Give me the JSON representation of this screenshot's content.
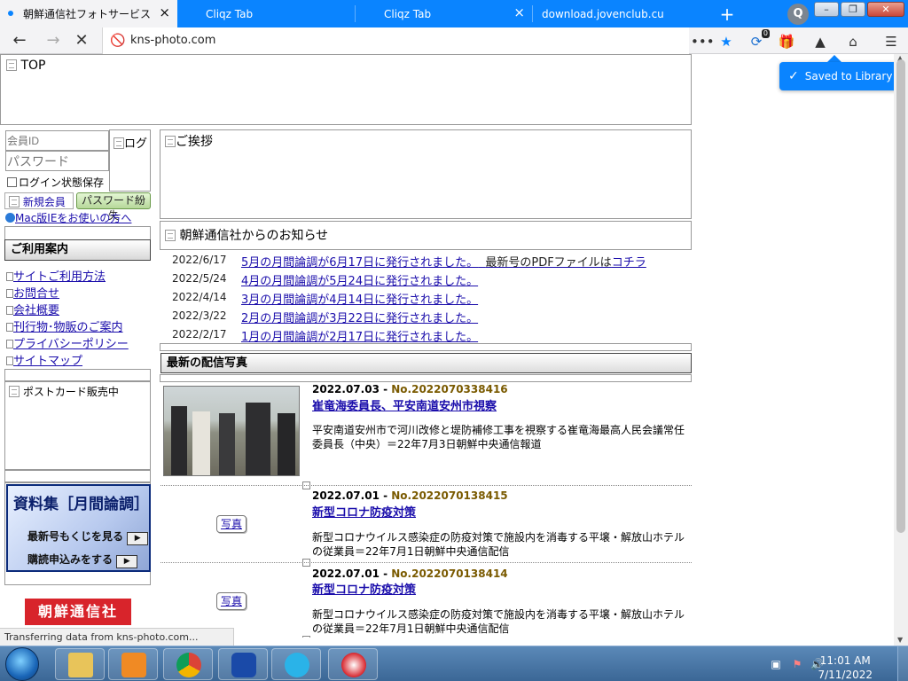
{
  "browser": {
    "tabs": [
      {
        "label": "朝鮮通信社フォトサービス",
        "active": true
      },
      {
        "label": "Cliqz Tab",
        "active": false
      },
      {
        "label": "Cliqz Tab",
        "active": false
      },
      {
        "label": "download.jovenclub.cu",
        "active": false
      }
    ],
    "url": "kns-photo.com",
    "toast": "Saved to Library!",
    "extension_badge": "0",
    "cliqz_logo": "Q"
  },
  "page": {
    "top_label": "TOP",
    "login": {
      "member_id_placeholder": "会員ID",
      "password_placeholder": "パスワード",
      "login_button": "ログ",
      "remember_label": "ログイン状態保存",
      "new_member": "新規会員",
      "forgot_password": "パスワード紛失",
      "mac_notice": "Mac版IEをお使いの方へ"
    },
    "guide_heading": "ご利用案内",
    "guide_links": [
      "サイトご利用方法",
      "お問合せ",
      "会社概要",
      "刊行物･物販のご案内",
      "プライバシーポリシー",
      "サイトマップ"
    ],
    "postcard": "ポストカード販売中",
    "banner": {
      "title": "資料集［月間論調］",
      "line1": "最新号もくじを見る",
      "line2": "購読申込みをする"
    },
    "kcna_logo": "朝鮮通信社",
    "greeting": "ご挨拶",
    "news_heading": "朝鮮通信社からのお知らせ",
    "news": [
      {
        "date": "2022/6/17",
        "text": "5月の月間論調が6月17日に発行されました。",
        "extra": "最新号のPDFファイルは",
        "extra_link": "コチラ"
      },
      {
        "date": "2022/5/24",
        "text": "4月の月間論調が5月24日に発行されました。"
      },
      {
        "date": "2022/4/14",
        "text": "3月の月間論調が4月14日に発行されました。"
      },
      {
        "date": "2022/3/22",
        "text": "2月の月間論調が3月22日に発行されました。"
      },
      {
        "date": "2022/2/17",
        "text": "1月の月間論調が2月17日に発行されました。"
      }
    ],
    "photos_heading": "最新の配信写真",
    "photos": [
      {
        "date": "2022.07.03",
        "no": "No.2022070338416",
        "title": "崔竜海委員長、平安南道安州市視察",
        "caption": "平安南道安州市で河川改修と堤防補修工事を視察する崔竜海最高人民会議常任委員長（中央）＝22年7月3日朝鮮中央通信報道"
      },
      {
        "date": "2022.07.01",
        "no": "No.2022070138415",
        "title": "新型コロナ防疫対策",
        "caption": "新型コロナウイルス感染症の防疫対策で施設内を消毒する平壌・解放山ホテルの従業員＝22年7月1日朝鮮中央通信配信",
        "button": "写真"
      },
      {
        "date": "2022.07.01",
        "no": "No.2022070138414",
        "title": "新型コロナ防疫対策",
        "caption": "新型コロナウイルス感染症の防疫対策で施設内を消毒する平壌・解放山ホテルの従業員＝22年7月1日朝鮮中央通信配信",
        "button": "写真"
      }
    ],
    "status": "Transferring data from kns-photo.com..."
  },
  "taskbar": {
    "time": "11:01 AM",
    "date": "7/11/2022"
  }
}
